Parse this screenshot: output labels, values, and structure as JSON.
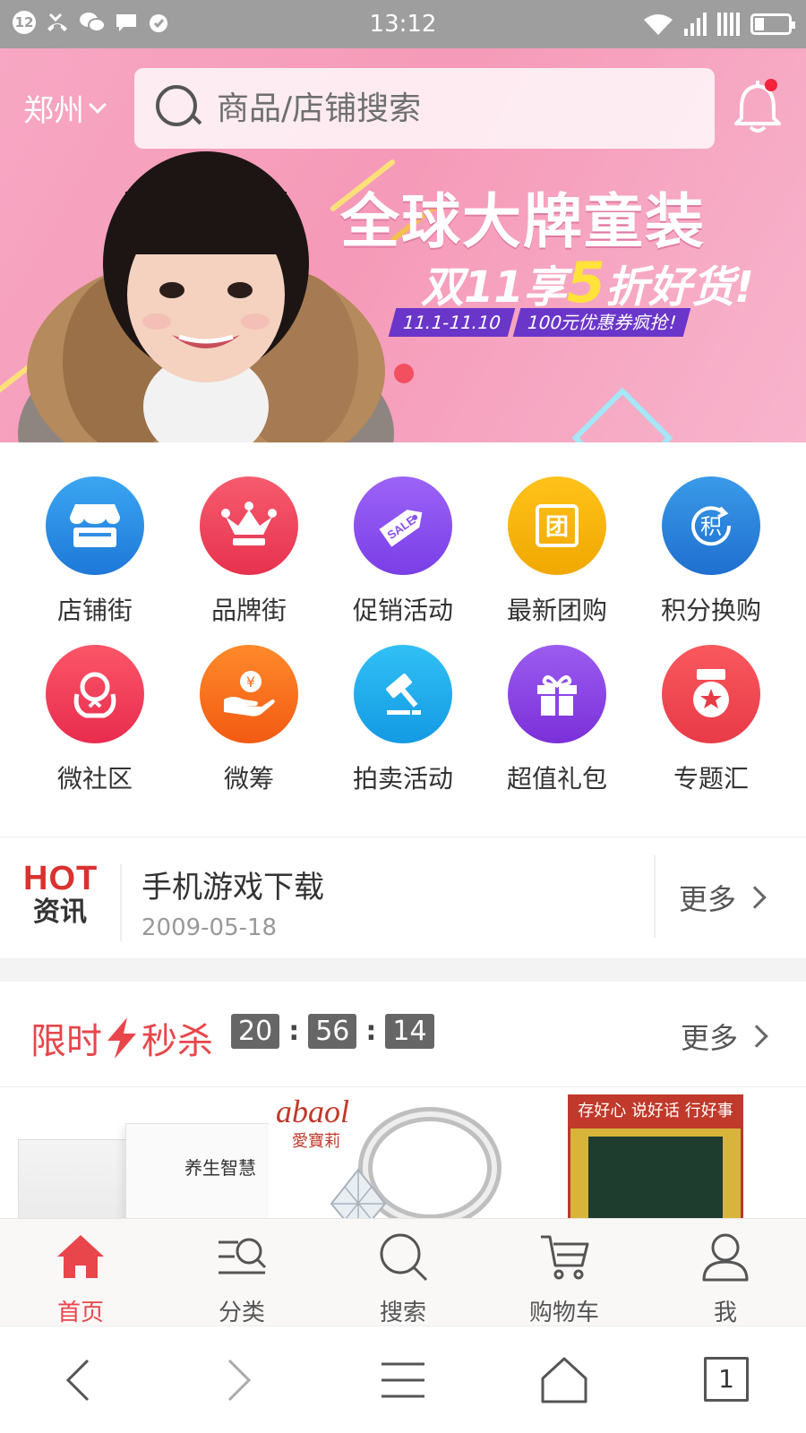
{
  "status_bar": {
    "time": "13:12",
    "notification_badge": "12",
    "icons": [
      "badge-12-icon",
      "missed-call-icon",
      "wechat-icon",
      "message-icon",
      "alarm-icon",
      "wifi-icon",
      "signal-icon",
      "signal-icon",
      "battery-icon"
    ]
  },
  "header": {
    "city": "郑州",
    "search_placeholder": "商品/店铺搜索",
    "bell_has_dot": true
  },
  "banner": {
    "title": "全球大牌童装",
    "subtitle_prefix": "双11享",
    "subtitle_highlight": "5",
    "subtitle_suffix": "折好货!",
    "date_range": "11.1-11.10",
    "coupon_text": "100元优惠券疯抢!",
    "colors": {
      "background": "#f59ab8",
      "highlight": "#ffe23a",
      "tag": "#6a35c9",
      "indicator": "#f24f5f"
    }
  },
  "categories": [
    {
      "label": "店铺街",
      "icon": "storefront-icon",
      "color": "#2f8fe6"
    },
    {
      "label": "品牌街",
      "icon": "crown-icon",
      "color": "#f0465e"
    },
    {
      "label": "促销活动",
      "icon": "sale-tag-icon",
      "color": "#8a4ff0"
    },
    {
      "label": "最新团购",
      "icon": "group-buy-icon",
      "color": "#f5b400"
    },
    {
      "label": "积分换购",
      "icon": "points-icon",
      "color": "#2e86e0"
    },
    {
      "label": "微社区",
      "icon": "community-icon",
      "color": "#f3415e"
    },
    {
      "label": "微筹",
      "icon": "crowdfund-icon",
      "color": "#f86e1f"
    },
    {
      "label": "拍卖活动",
      "icon": "auction-gavel-icon",
      "color": "#1ea6ec"
    },
    {
      "label": "超值礼包",
      "icon": "gift-icon",
      "color": "#8b43e6"
    },
    {
      "label": "专题汇",
      "icon": "medal-icon",
      "color": "#f04a56"
    }
  ],
  "news": {
    "badge_top": "HOT",
    "badge_bottom": "资讯",
    "title": "手机游戏下载",
    "date": "2009-05-18",
    "more": "更多"
  },
  "flash_sale": {
    "title_left": "限时",
    "title_right": "秒杀",
    "hours": "20",
    "minutes": "56",
    "seconds": "14",
    "more": "更多"
  },
  "products": [
    {
      "brand_text": "养生智慧"
    },
    {
      "logo": "abaol",
      "logo_sub": "愛寶莉"
    },
    {
      "top_text": "存好心 说好话 行好事 做好人"
    }
  ],
  "tabs": [
    {
      "label": "首页",
      "icon": "home-icon",
      "active": true
    },
    {
      "label": "分类",
      "icon": "category-search-icon",
      "active": false
    },
    {
      "label": "搜索",
      "icon": "search-icon",
      "active": false
    },
    {
      "label": "购物车",
      "icon": "cart-icon",
      "active": false
    },
    {
      "label": "我",
      "icon": "user-icon",
      "active": false
    }
  ],
  "system_nav": {
    "tab_count": "1"
  }
}
